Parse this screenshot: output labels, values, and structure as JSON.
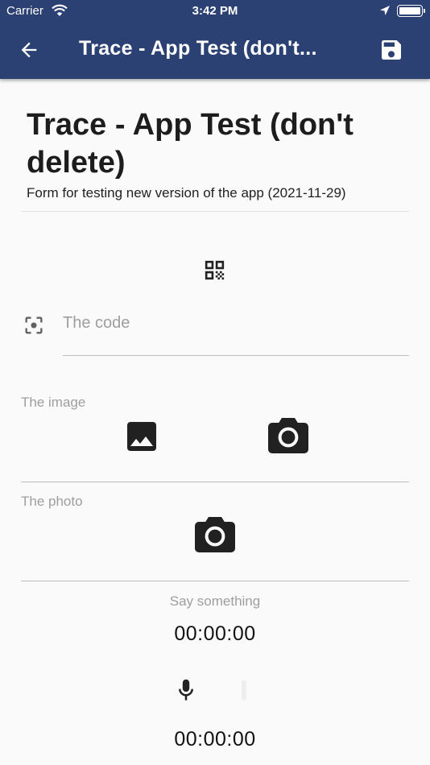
{
  "status_bar": {
    "carrier": "Carrier",
    "time": "3:42 PM"
  },
  "app_bar": {
    "title": "Trace - App Test (don't...",
    "back_icon": "arrow-back-icon",
    "save_icon": "floppy-save-icon",
    "background": "#2b4173"
  },
  "form": {
    "title": "Trace - App Test (don't delete)",
    "description": "Form for testing new version of the app (2021-11-29)"
  },
  "code_field": {
    "placeholder": "The code",
    "qr_icon": "qr-code-icon",
    "scan_icon": "scan-focus-icon"
  },
  "image_field": {
    "label": "The image",
    "gallery_icon": "image-gallery-icon",
    "camera_icon": "camera-icon"
  },
  "photo_field": {
    "label": "The photo",
    "camera_icon": "camera-icon"
  },
  "audio_field": {
    "label": "Say something",
    "elapsed": "00:00:00",
    "duration": "00:00:00",
    "mic_icon": "microphone-icon"
  }
}
